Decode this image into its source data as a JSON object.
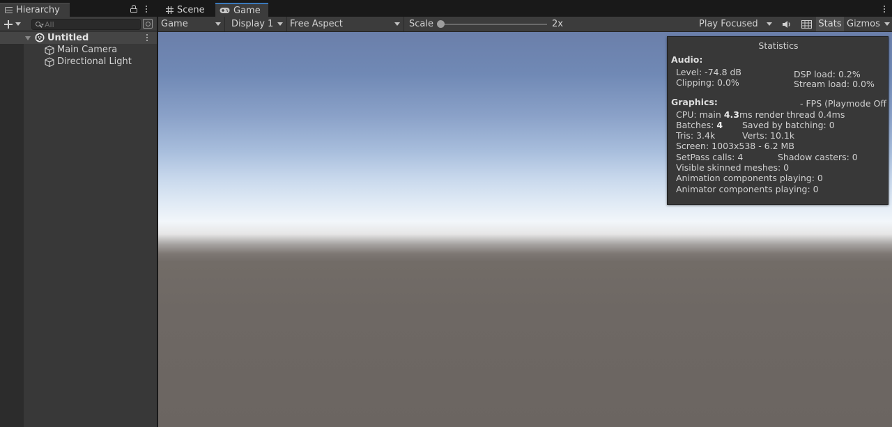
{
  "hierarchy": {
    "tab_label": "Hierarchy",
    "search_placeholder": "All",
    "scene_name": "Untitled",
    "items": [
      {
        "label": "Main Camera"
      },
      {
        "label": "Directional Light"
      }
    ]
  },
  "game_view": {
    "tabs": [
      {
        "label": "Scene"
      },
      {
        "label": "Game"
      }
    ],
    "active_tab": "Game",
    "toolbar": {
      "mode": "Game",
      "display": "Display 1",
      "aspect": "Free Aspect",
      "scale_label": "Scale",
      "scale_value": "2x",
      "play_mode": "Play Focused",
      "stats_label": "Stats",
      "gizmos_label": "Gizmos"
    }
  },
  "statistics": {
    "title": "Statistics",
    "audio_heading": "Audio:",
    "level": "Level: -74.8 dB",
    "clipping": "Clipping: 0.0%",
    "dsp_load": "DSP load: 0.2%",
    "stream_load": "Stream load: 0.0%",
    "graphics_heading": "Graphics:",
    "fps": "- FPS (Playmode Off",
    "cpu_prefix": "CPU: main ",
    "cpu_main": "4.3",
    "cpu_suffix": "ms  render thread 0.4ms",
    "batches_prefix": "Batches: ",
    "batches": "4",
    "saved_by_batching": "Saved by batching: 0",
    "tris": "Tris: 3.4k",
    "verts": "Verts: 10.1k",
    "screen": "Screen: 1003x538 - 6.2 MB",
    "setpass": "SetPass calls: 4",
    "shadow_casters": "Shadow casters: 0",
    "skinned": "Visible skinned meshes: 0",
    "animation": "Animation components playing: 0",
    "animator": "Animator components playing: 0"
  },
  "colors": {
    "panel_bg": "#383838",
    "tab_active_accent": "#3a79bb",
    "sky_top": "#6b7faa",
    "horizon": "#f2f6fa",
    "ground": "#6b6561"
  },
  "icons": [
    "hierarchy-lines-icon",
    "lock-icon",
    "kebab-menu-icon",
    "plus-icon",
    "search-icon",
    "unity-logo-icon",
    "gameobject-cube-icon",
    "grid-icon",
    "gamepad-icon",
    "audio-mute-icon"
  ]
}
